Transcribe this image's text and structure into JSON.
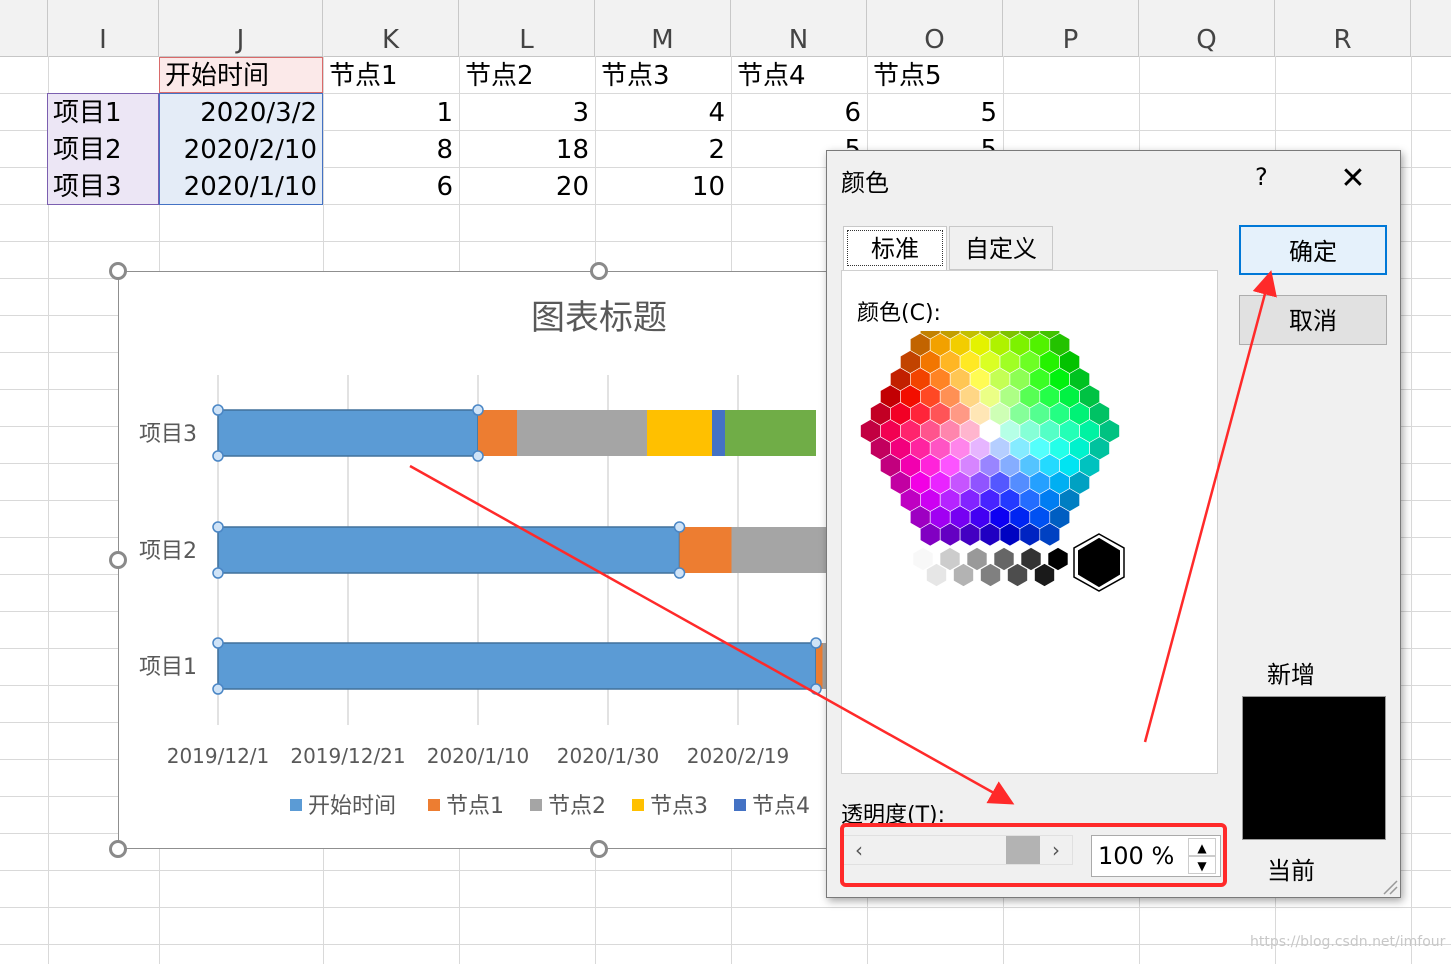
{
  "sheet": {
    "columns": [
      "I",
      "J",
      "K",
      "L",
      "M",
      "N",
      "O",
      "P",
      "Q",
      "R"
    ],
    "header_row": [
      "开始时间",
      "节点1",
      "节点2",
      "节点3",
      "节点4",
      "节点5"
    ],
    "rows": [
      {
        "name": "项目1",
        "start": "2020/3/2",
        "n1": "1",
        "n2": "3",
        "n3": "4",
        "n4": "6",
        "n5": "5"
      },
      {
        "name": "项目2",
        "start": "2020/2/10",
        "n1": "8",
        "n2": "18",
        "n3": "2",
        "n4": "5",
        "n5": "5"
      },
      {
        "name": "项目3",
        "start": "2020/1/10",
        "n1": "6",
        "n2": "20",
        "n3": "10"
      }
    ]
  },
  "chart": {
    "title": "图表标题",
    "legend": [
      "开始时间",
      "节点1",
      "节点2",
      "节点3",
      "节点4"
    ]
  },
  "chart_data": {
    "type": "bar",
    "orientation": "horizontal",
    "stacked": true,
    "title": "图表标题",
    "categories": [
      "项目1",
      "项目2",
      "项目3"
    ],
    "x_ticks": [
      "2019/12/1",
      "2019/12/21",
      "2020/1/10",
      "2020/1/30",
      "2020/2/19"
    ],
    "xlim": [
      "2019/12/1",
      "2020/3/20"
    ],
    "series": [
      {
        "name": "开始时间",
        "color": "#5b9bd5",
        "values": [
          "2020/3/2",
          "2020/2/10",
          "2020/1/10"
        ]
      },
      {
        "name": "节点1",
        "color": "#ed7d31",
        "values": [
          1,
          8,
          6
        ]
      },
      {
        "name": "节点2",
        "color": "#a5a5a5",
        "values": [
          3,
          18,
          20
        ]
      },
      {
        "name": "节点3",
        "color": "#ffc000",
        "values": [
          4,
          2,
          10
        ]
      },
      {
        "name": "节点4",
        "color": "#4472c4",
        "values": [
          6,
          5,
          2
        ]
      },
      {
        "name": "节点5",
        "color": "#70ad47",
        "values": [
          5,
          5,
          14
        ]
      }
    ],
    "legend_position": "bottom",
    "grid": true
  },
  "dialog": {
    "title": "颜色",
    "help": "?",
    "close": "✕",
    "tab_standard": "标准",
    "tab_custom": "自定义",
    "colors_label": "颜色(C):",
    "ok": "确定",
    "cancel": "取消",
    "new_label": "新增",
    "current_label": "当前",
    "transparency_label": "透明度(T):",
    "transparency_value": "100 %",
    "new_color": "#000000"
  },
  "watermark": "https://blog.csdn.net/imfour"
}
